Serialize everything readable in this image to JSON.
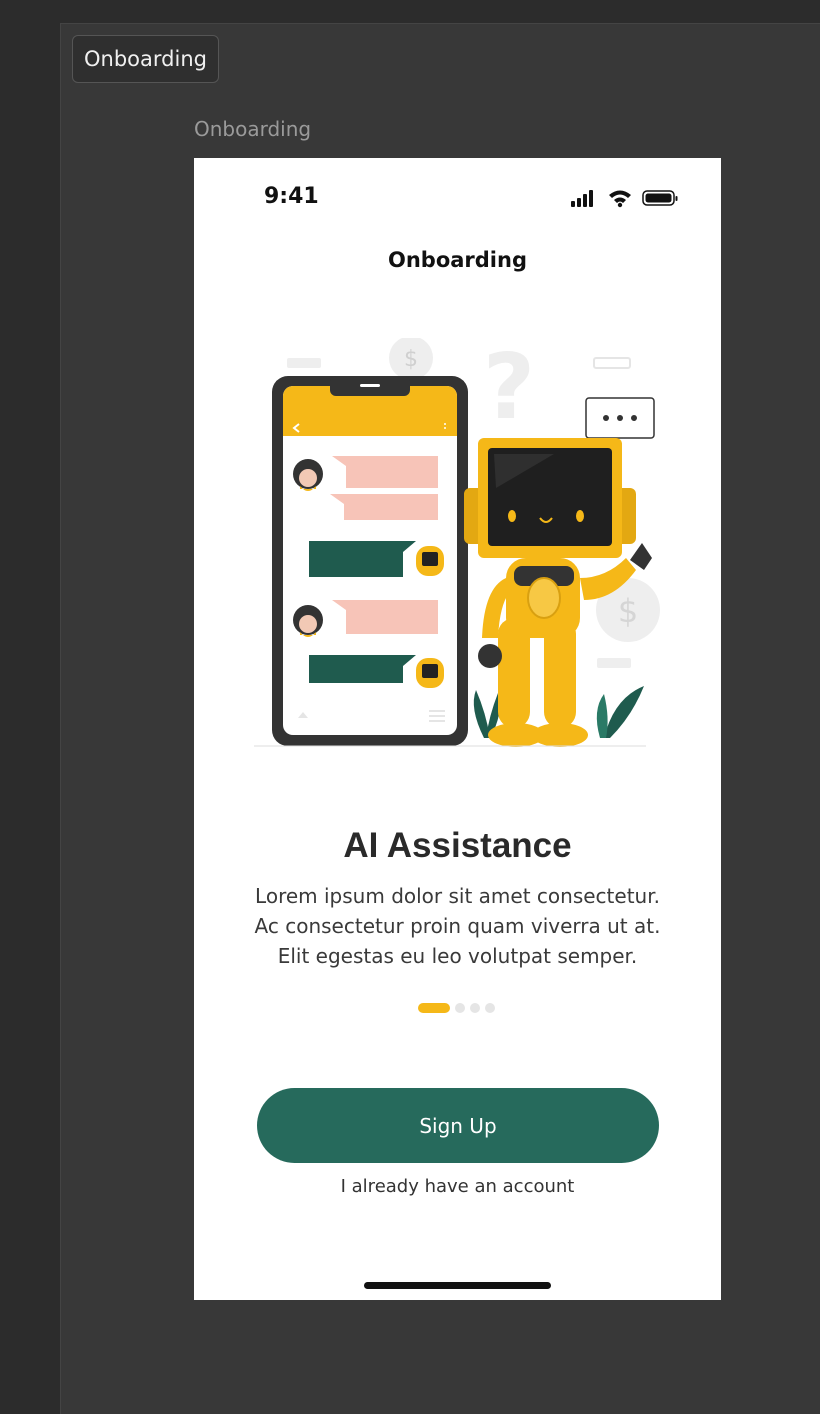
{
  "canvas": {
    "tab_label": "Onboarding",
    "frame_label": "Onboarding"
  },
  "status_bar": {
    "time": "9:41",
    "icons": [
      "signal-icon",
      "wifi-icon",
      "battery-icon"
    ]
  },
  "screen": {
    "title": "Onboarding",
    "headline": "AI Assistance",
    "body_lines": [
      "Lorem ipsum dolor sit amet consectetur.",
      "Ac consectetur proin quam viverra ut at.",
      "Elit egestas eu leo volutpat semper."
    ],
    "pagination": {
      "total": 4,
      "active": 1
    },
    "primary_button": "Sign Up",
    "secondary_link": "I already have an account"
  },
  "colors": {
    "accent": "#f5b818",
    "primary": "#266a5c",
    "chat_pink": "#f7c4b8",
    "chat_green": "#1f5b4e",
    "background_canvas": "#383838"
  }
}
